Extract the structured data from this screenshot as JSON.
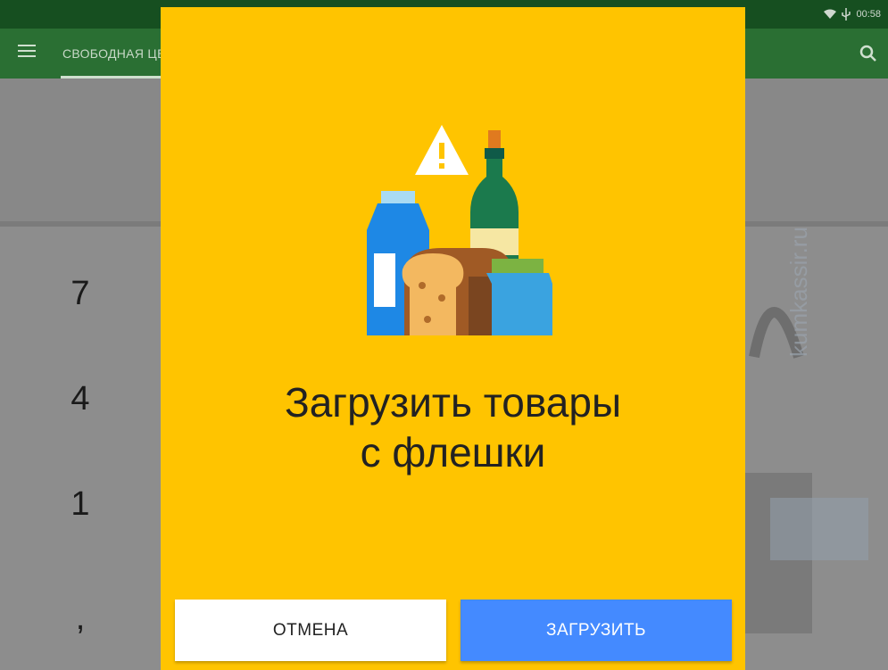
{
  "status_bar": {
    "time": "00:58",
    "wifi_icon": "wifi-icon",
    "usb_icon": "usb-icon",
    "color": "#164f20"
  },
  "app_bar": {
    "tab_label": "СВОБОДНАЯ ЦЕНА",
    "menu_icon": "menu-icon",
    "search_icon": "search-icon",
    "color": "#2a6f33"
  },
  "keypad": {
    "keys": [
      "7",
      "4",
      "1",
      ","
    ]
  },
  "watermark": "kumkassir.ru",
  "dialog": {
    "background": "#ffc400",
    "title_line1": "Загрузить товары",
    "title_line2": "с флешки",
    "illustration_icon": "groceries-warning-illustration",
    "cancel_label": "ОТМЕНА",
    "load_label": "ЗАГРУЗИТЬ",
    "load_color": "#448aff"
  }
}
